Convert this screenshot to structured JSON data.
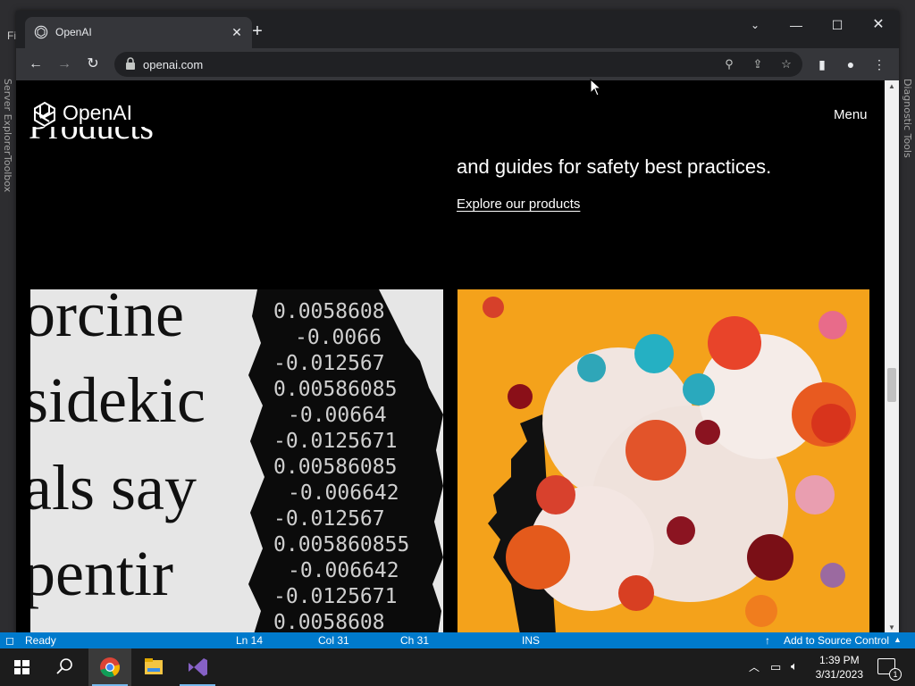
{
  "background_app": {
    "left_rail_labels": [
      "Server Explorer",
      "Toolbox"
    ],
    "right_rail_label": "Diagnostic Tools",
    "menu_letter": "Fi"
  },
  "browser": {
    "tab": {
      "title": "OpenAI",
      "close_icon": "close-icon"
    },
    "new_tab_icon": "plus-icon",
    "window_controls": [
      "chevron-down-icon",
      "minimize-icon",
      "maximize-icon",
      "close-icon"
    ],
    "address_bar": {
      "url": "openai.com",
      "lock_icon": "lock-icon"
    },
    "toolbar_icons": [
      "search-icon",
      "share-icon",
      "star-icon",
      "side-panel-icon",
      "profile-icon",
      "more-icon"
    ]
  },
  "page": {
    "logo_text": "OpenAI",
    "menu_label": "Menu",
    "section_heading": "Products",
    "safety_text": "and guides for safety best practices.",
    "explore_link": "Explore our products",
    "left_image": {
      "paper_lines": [
        "orcine",
        "sidekic",
        "als say",
        "pentir"
      ],
      "code_lines": [
        "0.0058608",
        "-0.0066",
        "-0.012567",
        "0.00586085",
        "-0.00664",
        "-0.0125671",
        "0.00586085",
        "-0.006642",
        "-0.012567",
        "0.005860855",
        "-0.006642",
        "-0.0125671",
        "0.0058608"
      ]
    }
  },
  "status_bar": {
    "ready": "Ready",
    "ln": "Ln 14",
    "col": "Col 31",
    "ch": "Ch 31",
    "ins": "INS",
    "source_control": "Add to Source Control"
  },
  "taskbar": {
    "time": "1:39 PM",
    "date": "3/31/2023",
    "notification_count": "1",
    "apps": [
      "start-icon",
      "search-icon",
      "chrome-icon",
      "file-explorer-icon",
      "visual-studio-icon"
    ]
  }
}
